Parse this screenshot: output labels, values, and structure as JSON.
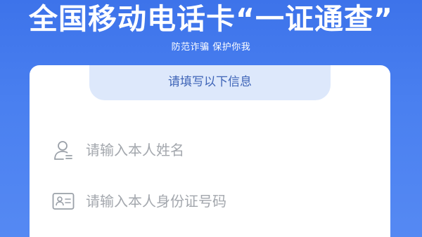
{
  "header": {
    "title": "全国移动电话卡“一证通查”",
    "subtitle": "防范诈骗 保护你我"
  },
  "form": {
    "section_title": "请填写以下信息",
    "name_field": {
      "icon": "user-icon",
      "placeholder": "请输入本人姓名",
      "value": ""
    },
    "id_field": {
      "icon": "id-card-icon",
      "placeholder": "请输入本人身份证号码",
      "value": ""
    }
  },
  "colors": {
    "background": "#4a80f0",
    "tab_background": "#dde8fb",
    "tab_text": "#3e64b7",
    "placeholder": "#a3a7ad"
  }
}
